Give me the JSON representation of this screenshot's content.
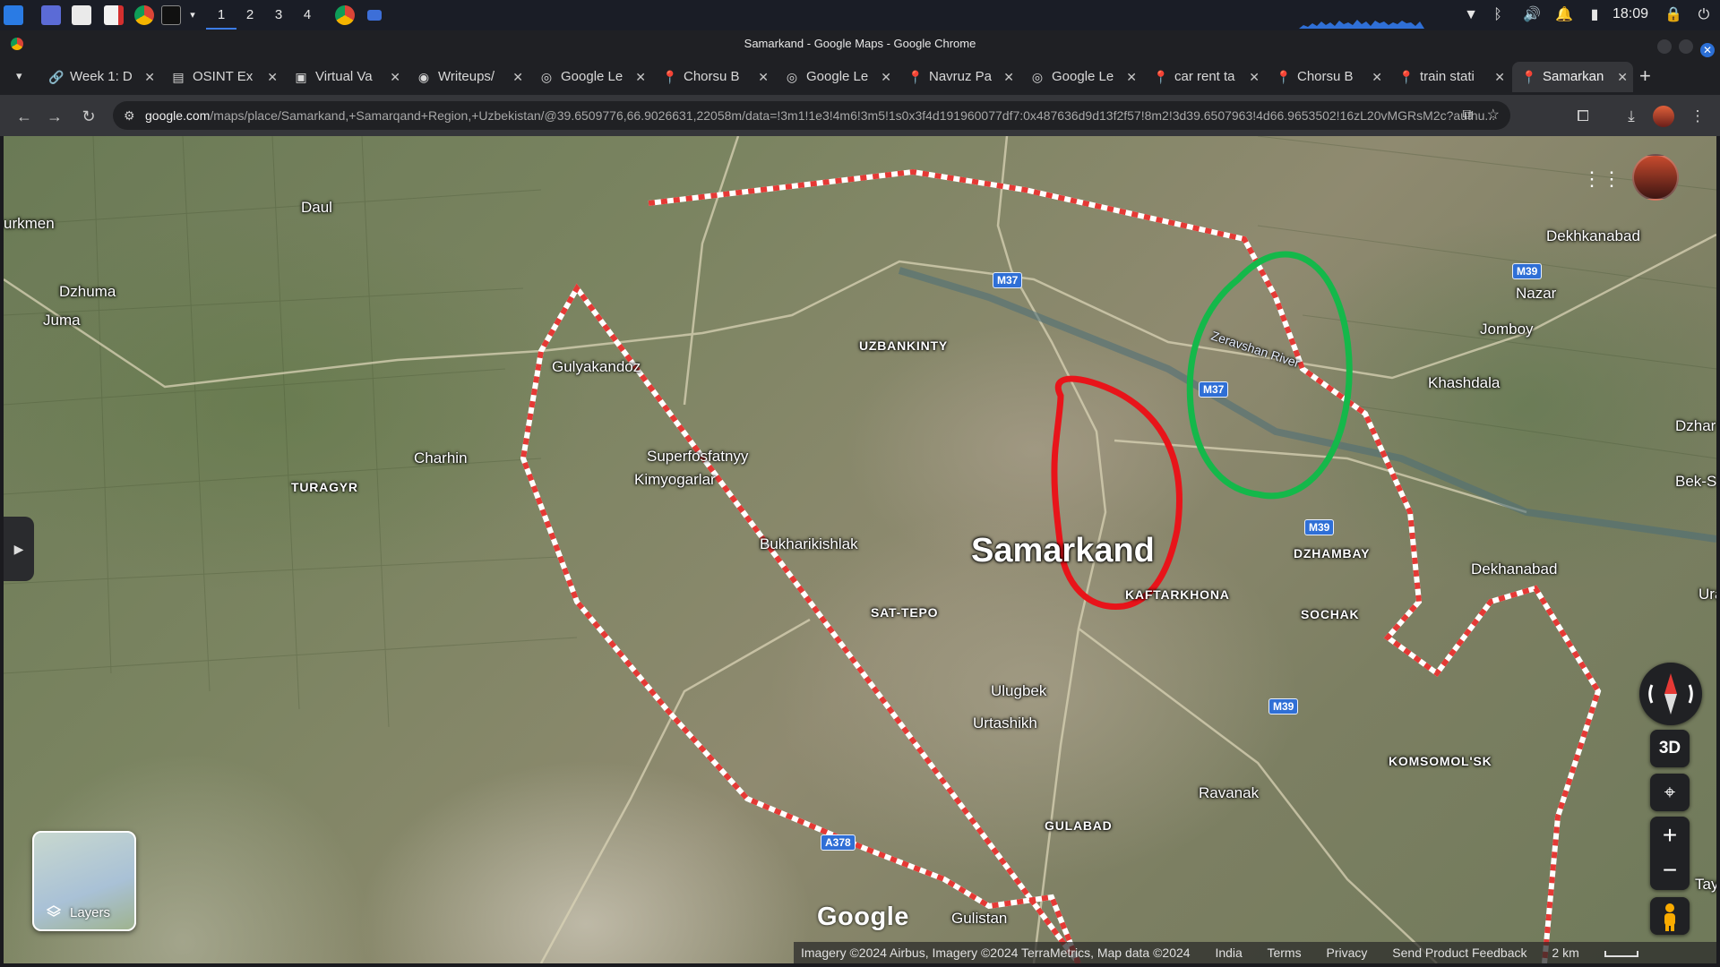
{
  "taskbar": {
    "workspaces": [
      "1",
      "2",
      "3",
      "4"
    ],
    "clock": "18:09"
  },
  "window": {
    "title": "Samarkand - Google Maps - Google Chrome"
  },
  "tabs": [
    {
      "label": "Week 1: D",
      "icon": "link-icon"
    },
    {
      "label": "OSINT Ex",
      "icon": "doc-icon"
    },
    {
      "label": "Virtual Va",
      "icon": "vault-icon"
    },
    {
      "label": "Writeups/",
      "icon": "github-icon"
    },
    {
      "label": "Google Le",
      "icon": "lens-icon"
    },
    {
      "label": "Chorsu B",
      "icon": "maps-pin-icon"
    },
    {
      "label": "Google Le",
      "icon": "lens-icon"
    },
    {
      "label": "Navruz Pa",
      "icon": "maps-pin-icon"
    },
    {
      "label": "Google Le",
      "icon": "lens-icon"
    },
    {
      "label": "car rent ta",
      "icon": "maps-pin-icon"
    },
    {
      "label": "Chorsu B",
      "icon": "maps-pin-icon"
    },
    {
      "label": "train stati",
      "icon": "maps-pin-icon"
    },
    {
      "label": "Samarkan",
      "icon": "maps-pin-icon",
      "active": true
    }
  ],
  "omnibox": {
    "host": "google.com",
    "path": "/maps/place/Samarkand,+Samarqand+Region,+Uzbekistan/@39.6509776,66.9026631,22058m/data=!3m1!1e3!4m6!3m5!1s0x3f4d191960077df7:0x487636d9d13f2f57!8m2!3d39.6507963!4d66.9653502!16zL20vMGRsM2c?authu..."
  },
  "map": {
    "labels": {
      "turkmen": "urkmen",
      "daul": "Daul",
      "dzhuma": "Dzhuma",
      "juma": "Juma",
      "gulyakandoz": "Gulyakandoz",
      "uzbankinty": "UZBANKINTY",
      "charhin": "Charhin",
      "turagyr": "TURAGYR",
      "superfosfatnyy": "Superfosfatnyy",
      "kimyogarlar": "Kimyogarlar",
      "bukharikishlak": "Bukharikishlak",
      "samarkand": "Samarkand",
      "sat_tepo": "SAT-TEPO",
      "kaftarkhona": "KAFTARKHONA",
      "dzhambay": "DZHAMBAY",
      "sochak": "SOCHAK",
      "ulugbek": "Ulugbek",
      "urtashikh": "Urtashikh",
      "ravanak": "Ravanak",
      "gulabad": "GULABAD",
      "gulistan": "Gulistan",
      "komsomolsk": "KOMSOMOL'SK",
      "dekhanabad": "Dekhanabad",
      "dekhkanabad": "Dekhkanabad",
      "nazar": "Nazar",
      "jomboy": "Jomboy",
      "khashdala": "Khashdala",
      "dzhar": "Dzhar",
      "bek_s": "Bek-S",
      "ura": "Ura",
      "tay": "Tay",
      "zeravshan": "Zeravshan River"
    },
    "road_shields": [
      "M37",
      "M37",
      "M39",
      "M39",
      "M39",
      "A378"
    ],
    "layers_label": "Layers",
    "btn_3d": "3D",
    "google_logo": "Google",
    "attribution": {
      "imagery": "Imagery ©2024 Airbus, Imagery ©2024 TerraMetrics, Map data ©2024",
      "country": "India",
      "terms": "Terms",
      "privacy": "Privacy",
      "feedback": "Send Product Feedback",
      "scale": "2 km"
    },
    "annotations": {
      "red_circle_color": "#e8141a",
      "green_circle_color": "#14b84a",
      "boundary_color": "#e53935"
    }
  }
}
